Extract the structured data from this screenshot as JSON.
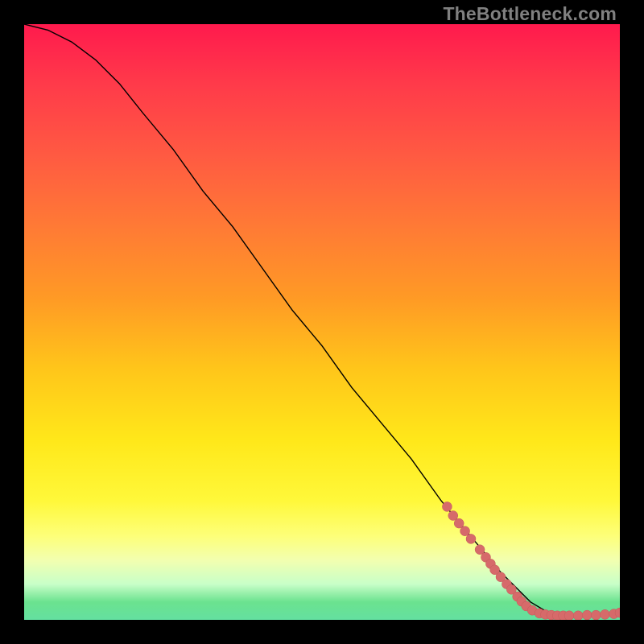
{
  "watermark": "TheBottleneck.com",
  "colors": {
    "dot": "#d66a6a",
    "line": "#000000"
  },
  "chart_data": {
    "type": "line",
    "title": "",
    "xlabel": "",
    "ylabel": "",
    "xlim": [
      0,
      100
    ],
    "ylim": [
      0,
      100
    ],
    "grid": false,
    "series": [
      {
        "name": "curve",
        "x": [
          0,
          4,
          8,
          12,
          16,
          20,
          25,
          30,
          35,
          40,
          45,
          50,
          55,
          60,
          65,
          70,
          75,
          80,
          85,
          88,
          90,
          92,
          94,
          96,
          98,
          100
        ],
        "y": [
          100,
          99,
          97,
          94,
          90,
          85,
          79,
          72,
          66,
          59,
          52,
          46,
          39,
          33,
          27,
          20,
          14,
          8,
          3,
          1.2,
          0.8,
          0.7,
          0.7,
          0.8,
          0.9,
          1.2
        ]
      }
    ],
    "points": [
      {
        "x": 71,
        "y": 19.0
      },
      {
        "x": 72,
        "y": 17.5
      },
      {
        "x": 73,
        "y": 16.2
      },
      {
        "x": 74,
        "y": 14.9
      },
      {
        "x": 75,
        "y": 13.6
      },
      {
        "x": 76.5,
        "y": 11.8
      },
      {
        "x": 77.5,
        "y": 10.5
      },
      {
        "x": 78.3,
        "y": 9.4
      },
      {
        "x": 79,
        "y": 8.4
      },
      {
        "x": 80,
        "y": 7.2
      },
      {
        "x": 81,
        "y": 6.0
      },
      {
        "x": 81.8,
        "y": 5.1
      },
      {
        "x": 82.8,
        "y": 3.9
      },
      {
        "x": 83.5,
        "y": 3.1
      },
      {
        "x": 84.3,
        "y": 2.3
      },
      {
        "x": 85.3,
        "y": 1.6
      },
      {
        "x": 86.5,
        "y": 1.1
      },
      {
        "x": 87.5,
        "y": 0.9
      },
      {
        "x": 88.5,
        "y": 0.8
      },
      {
        "x": 89.5,
        "y": 0.7
      },
      {
        "x": 90.5,
        "y": 0.7
      },
      {
        "x": 91.5,
        "y": 0.7
      },
      {
        "x": 93,
        "y": 0.7
      },
      {
        "x": 94.5,
        "y": 0.8
      },
      {
        "x": 96,
        "y": 0.8
      },
      {
        "x": 97.5,
        "y": 0.9
      },
      {
        "x": 99,
        "y": 1.0
      },
      {
        "x": 100,
        "y": 1.2
      }
    ]
  }
}
